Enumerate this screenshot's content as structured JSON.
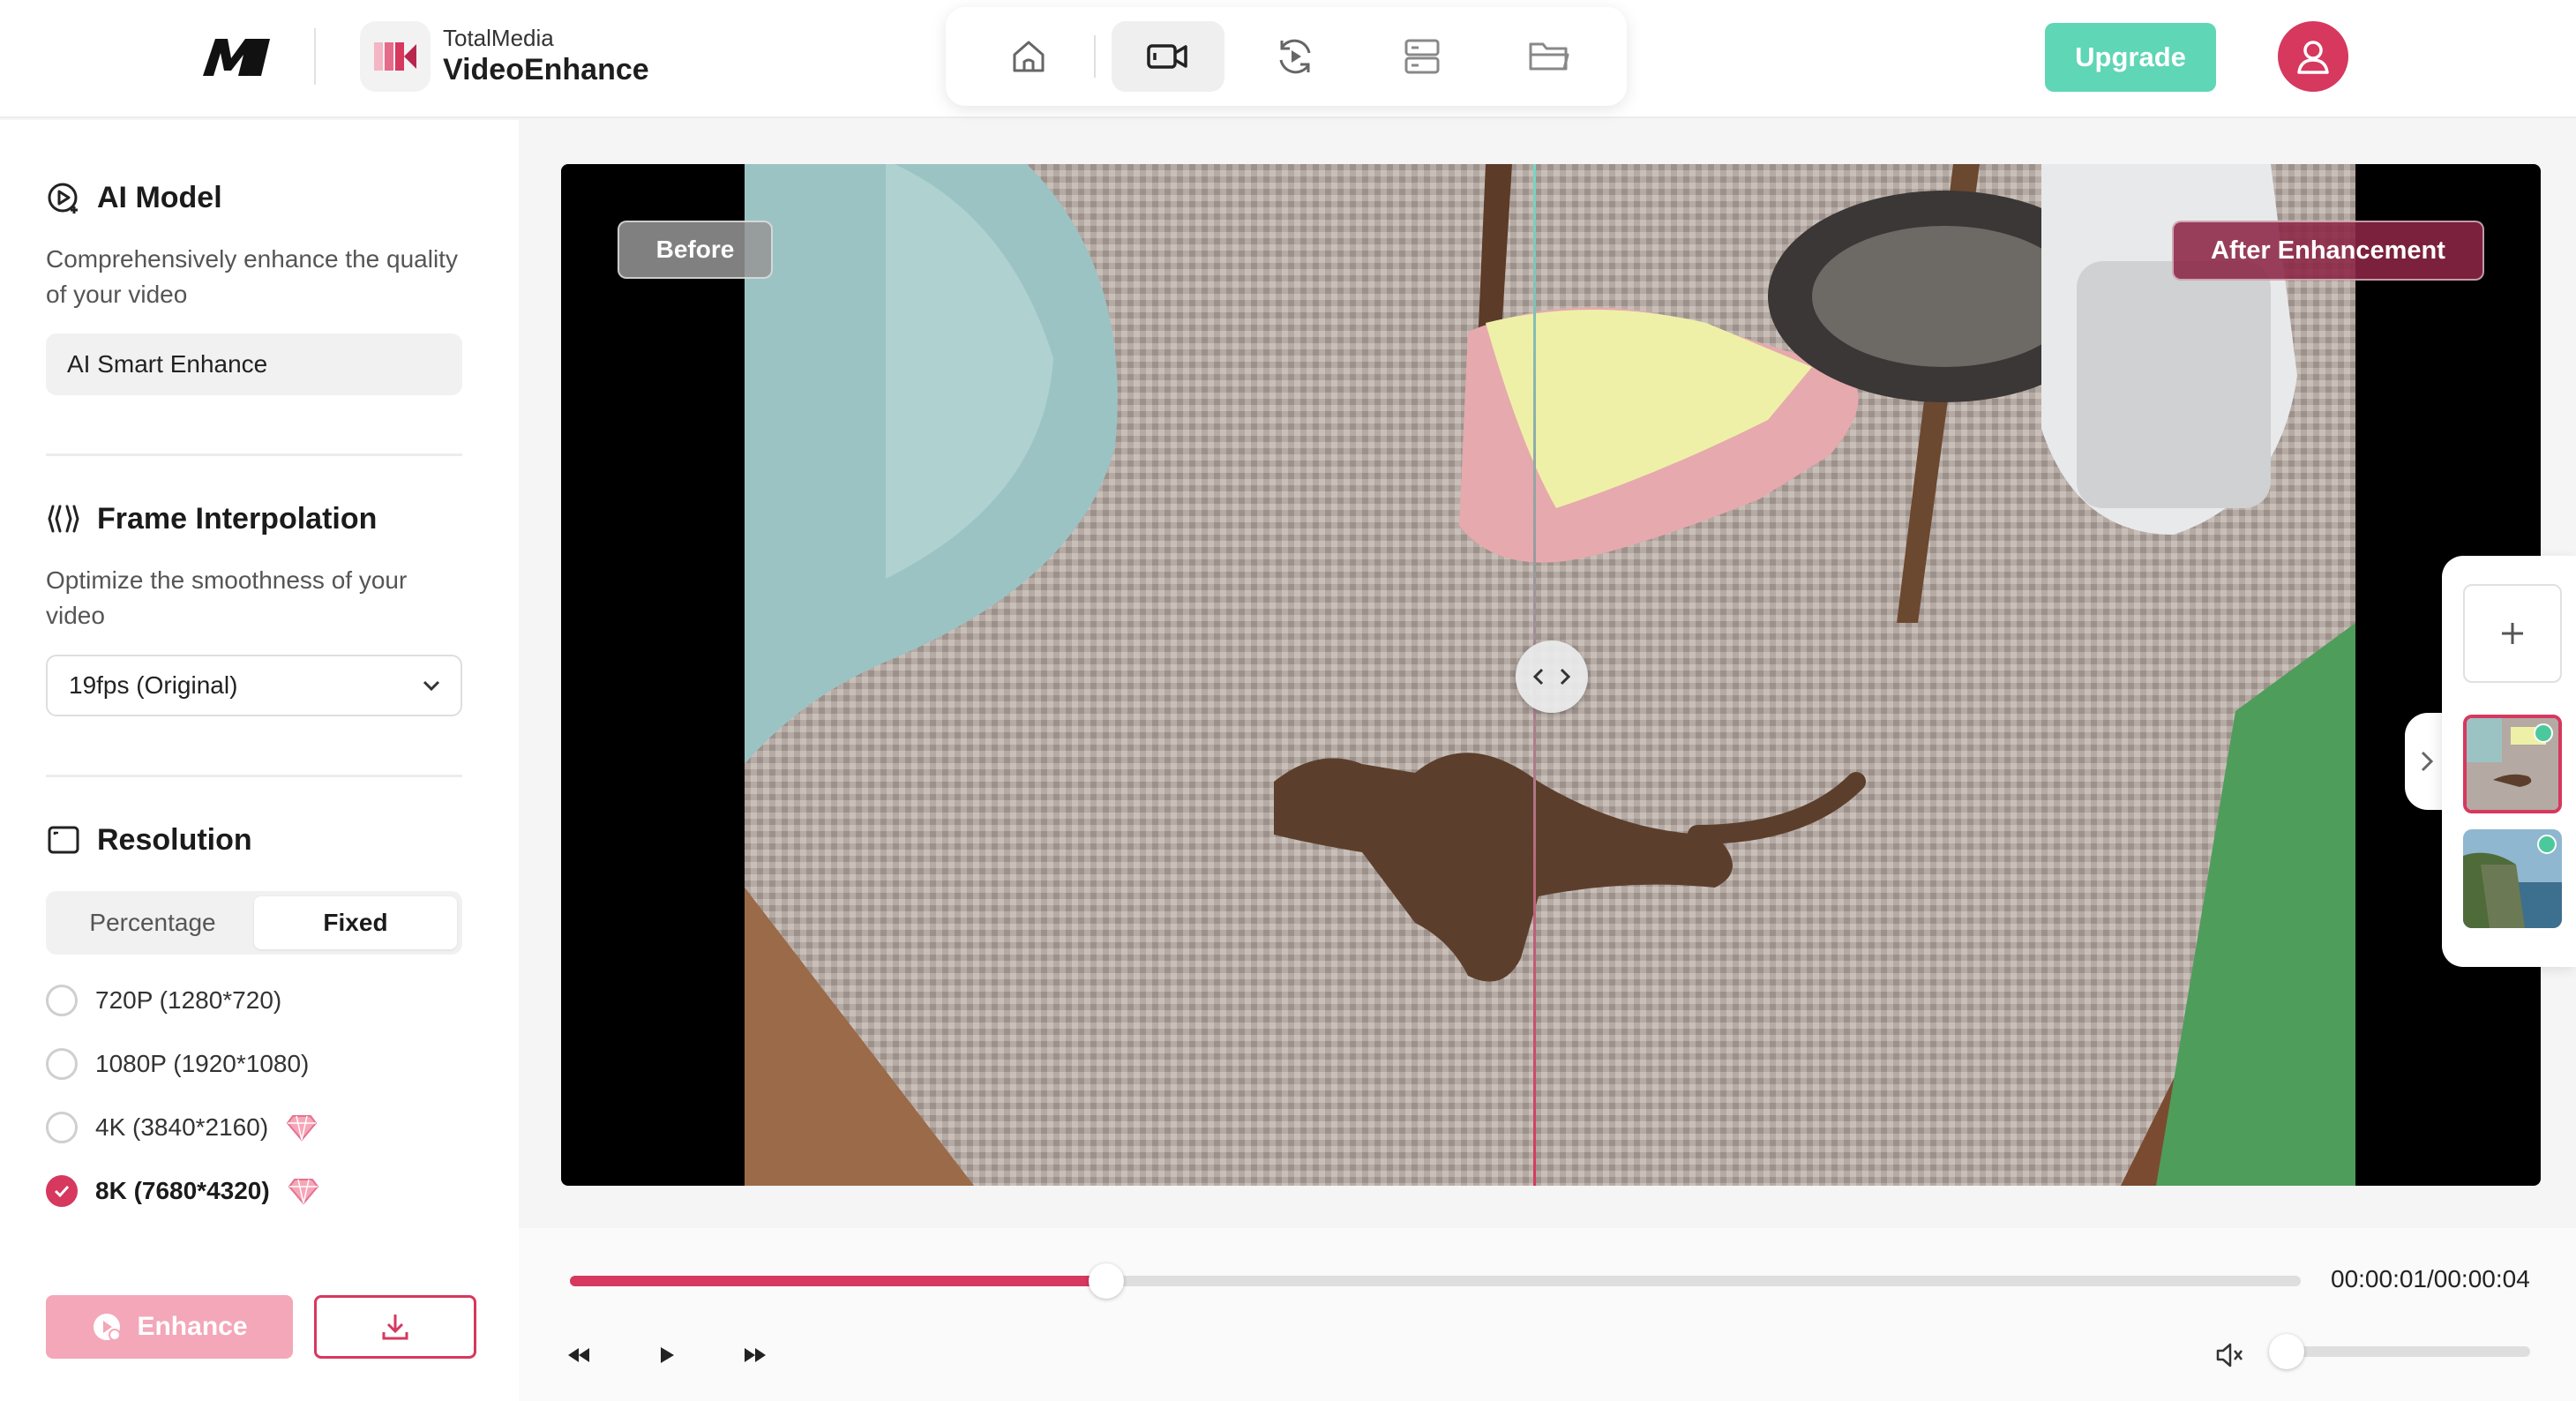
{
  "header": {
    "brand_logo": "M",
    "app_brand": "TotalMedia",
    "app_name": "VideoEnhance",
    "nav": [
      {
        "icon": "home-icon",
        "active": false
      },
      {
        "icon": "video-camera-icon",
        "active": true
      },
      {
        "icon": "refresh-play-icon",
        "active": false
      },
      {
        "icon": "server-list-icon",
        "active": false
      },
      {
        "icon": "folder-icon",
        "active": false
      }
    ],
    "upgrade_label": "Upgrade",
    "avatar_icon": "user-icon"
  },
  "sidebar": {
    "ai_model": {
      "title": "AI Model",
      "desc": "Comprehensively enhance the quality of your video",
      "value": "AI Smart Enhance"
    },
    "frame_interpolation": {
      "title": "Frame Interpolation",
      "desc": "Optimize the smoothness of your video",
      "value": "19fps (Original)"
    },
    "resolution": {
      "title": "Resolution",
      "tabs": [
        "Percentage",
        "Fixed"
      ],
      "active_tab": "Fixed",
      "options": [
        {
          "label": "720P (1280*720)",
          "checked": false,
          "premium": false
        },
        {
          "label": "1080P (1920*1080)",
          "checked": false,
          "premium": false
        },
        {
          "label": "4K (3840*2160)",
          "checked": false,
          "premium": true
        },
        {
          "label": "8K (7680*4320)",
          "checked": true,
          "premium": true
        }
      ]
    },
    "enhance_label": "Enhance"
  },
  "preview": {
    "before_label": "Before",
    "after_label": "After Enhancement"
  },
  "playback": {
    "time": "00:00:01/00:00:04",
    "progress": 0.31,
    "volume": 0.0
  },
  "colors": {
    "accent": "#d6385e",
    "upgrade": "#5fd6b5"
  }
}
